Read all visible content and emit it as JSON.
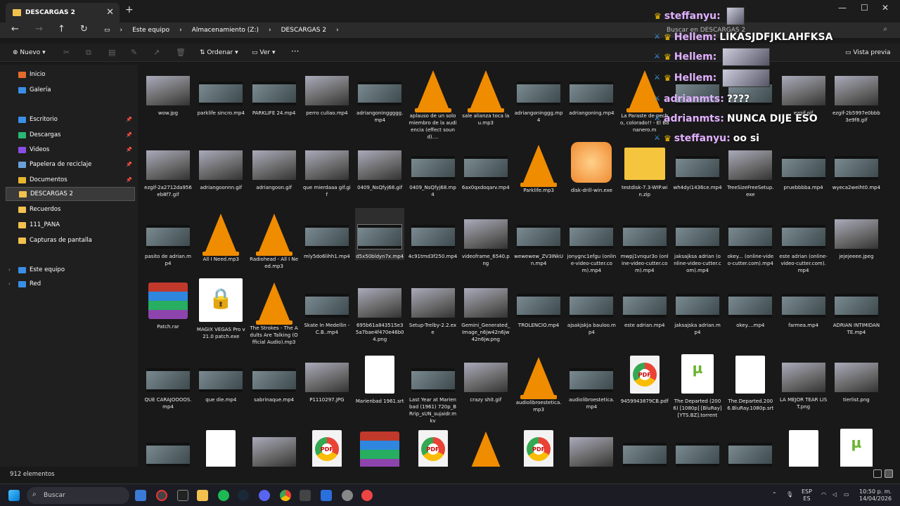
{
  "window": {
    "tab_title": "DESCARGAS 2",
    "new_tab": "+"
  },
  "window_controls": {
    "minimize": "—",
    "maximize": "☐",
    "close": "✕"
  },
  "nav": {
    "back": "←",
    "forward": "→",
    "up": "↑",
    "refresh": "↻"
  },
  "breadcrumb": [
    "Este equipo",
    "Almacenamiento (Z:)",
    "DESCARGAS 2"
  ],
  "search": {
    "placeholder": "Buscar en DESCARGAS 2"
  },
  "toolbar": {
    "new": "Nuevo",
    "sort": "Ordenar",
    "view": "Ver",
    "more": "···",
    "preview": "Vista previa"
  },
  "sidebar": {
    "items": [
      {
        "label": "Inicio",
        "color": "#e36b2c"
      },
      {
        "label": "Galería",
        "color": "#3a8ee6"
      },
      {
        "label": "Escritorio",
        "color": "#3a8ee6",
        "pinned": true
      },
      {
        "label": "Descargas",
        "color": "#2bb673",
        "pinned": true
      },
      {
        "label": "Videos",
        "color": "#8a4de6",
        "pinned": true
      },
      {
        "label": "Papelera de reciclaje",
        "color": "#6aa0d8",
        "pinned": true
      },
      {
        "label": "Documentos",
        "color": "#e8b730",
        "pinned": true
      },
      {
        "label": "DESCARGAS 2",
        "color": "#f2c14e"
      },
      {
        "label": "Recuerdos",
        "color": "#f2c14e"
      },
      {
        "label": "111_PANA",
        "color": "#f2c14e"
      },
      {
        "label": "Capturas de pantalla",
        "color": "#f2c14e"
      },
      {
        "label": "Este equipo",
        "color": "#3a8ee6"
      },
      {
        "label": "Red",
        "color": "#3a8ee6"
      }
    ]
  },
  "files": [
    {
      "name": "wow.jpg",
      "kind": "img"
    },
    {
      "name": "parklife sincro.mp4",
      "kind": "vid"
    },
    {
      "name": "PARKLIFE 24.mp4",
      "kind": "vid"
    },
    {
      "name": "perro culiao.mp4",
      "kind": "img"
    },
    {
      "name": "adriangoninggggg.mp4",
      "kind": "vid"
    },
    {
      "name": "aplauso de un solo miembro de la audiencia (effect sound)....",
      "kind": "cone"
    },
    {
      "name": "sale alianza toca la u.mp3",
      "kind": "cone"
    },
    {
      "name": "adriangoninggg.mp4",
      "kind": "vid"
    },
    {
      "name": "adriangoning.mp4",
      "kind": "vid"
    },
    {
      "name": "La Paraste de pecho, colorado!! - El Bananero.m",
      "kind": "cone"
    },
    {
      "name": "",
      "kind": "vid"
    },
    {
      "name": "",
      "kind": "vid"
    },
    {
      "name": "ezgif.gif",
      "kind": "img"
    },
    {
      "name": "ezgif-2b5997e0bbb3e9f8.gif",
      "kind": "img"
    },
    {
      "name": "ezgif-2a2712da956eb8f7.gif",
      "kind": "img"
    },
    {
      "name": "adriangoonnn.gif",
      "kind": "img"
    },
    {
      "name": "adriangoon.gif",
      "kind": "img"
    },
    {
      "name": "que mierdaaa gif.gif",
      "kind": "img"
    },
    {
      "name": "0409_NsQfyj68.gif",
      "kind": "img"
    },
    {
      "name": "0409_NsQfyj68.mp4",
      "kind": "vid"
    },
    {
      "name": "6ax0qxdoqarv.mp4",
      "kind": "vid"
    },
    {
      "name": "Parklife.mp3",
      "kind": "cone"
    },
    {
      "name": "disk-drill-win.exe",
      "kind": "app"
    },
    {
      "name": "testdisk-7.3-WIP.win.zip",
      "kind": "zip"
    },
    {
      "name": "wh4dyi1436ce.mp4",
      "kind": "vid"
    },
    {
      "name": "TreeSizeFreeSetup.exe",
      "kind": "img"
    },
    {
      "name": "pruebbbba.mp4",
      "kind": "vid"
    },
    {
      "name": "wyeca2weiht0.mp4",
      "kind": "vid"
    },
    {
      "name": "pasito de adrian.mp4",
      "kind": "vid"
    },
    {
      "name": "All I Need.mp3",
      "kind": "cone"
    },
    {
      "name": "Radiohead - All I Need.mp3",
      "kind": "cone"
    },
    {
      "name": "mly5do6lihh1.mp4",
      "kind": "vid"
    },
    {
      "name": "d5x50bldyn7x.mp4",
      "kind": "vid",
      "selected": true
    },
    {
      "name": "4c91tmd3f250.mp4",
      "kind": "vid"
    },
    {
      "name": "videoframe_6540.png",
      "kind": "img"
    },
    {
      "name": "wewewew_ZV3INkUn.mp4",
      "kind": "vid"
    },
    {
      "name": "jonygnc1efgu (online-video-cutter.com).mp4",
      "kind": "vid"
    },
    {
      "name": "mwpj1vnqur3o (online-video-cutter.com).mp4",
      "kind": "vid"
    },
    {
      "name": "jaksajksa adrian (online-video-cutter.com).mp4",
      "kind": "vid"
    },
    {
      "name": "okey... (online-video-cutter.com).mp4",
      "kind": "vid"
    },
    {
      "name": "este adrian (online-video-cutter.com).mp4",
      "kind": "vid"
    },
    {
      "name": "jejejeeee.jpeg",
      "kind": "img"
    },
    {
      "name": "Patch.rar",
      "kind": "rar"
    },
    {
      "name": "MAGIX VEGAS Pro v21.0 patch.exe",
      "kind": "lock"
    },
    {
      "name": "The Strokes - The Adults Are Talking (Official Audio).mp3",
      "kind": "cone"
    },
    {
      "name": "Skate In Medellin - C.B..mp4",
      "kind": "vid"
    },
    {
      "name": "695b61a843515e35a7bae4f470e46b04.png",
      "kind": "img"
    },
    {
      "name": "Setup-Trelby-2.2.exe",
      "kind": "img"
    },
    {
      "name": "Gemini_Generated_Image_n6jw42n6jw42n6jw.png",
      "kind": "img"
    },
    {
      "name": "TROLENCIO.mp4",
      "kind": "vid"
    },
    {
      "name": "ajsakjskja bauloo.mp4",
      "kind": "vid"
    },
    {
      "name": "este adrian.mp4",
      "kind": "vid"
    },
    {
      "name": "jaksajska adrian.mp4",
      "kind": "vid"
    },
    {
      "name": "okey....mp4",
      "kind": "vid"
    },
    {
      "name": "farmea.mp4",
      "kind": "vid"
    },
    {
      "name": "ADRIAN INTIMIDANTE.mp4",
      "kind": "vid"
    },
    {
      "name": "QUE CARAJOOOOS.mp4",
      "kind": "vid"
    },
    {
      "name": "que die.mp4",
      "kind": "vid"
    },
    {
      "name": "sabrinaque.mp4",
      "kind": "vid"
    },
    {
      "name": "P1110297.JPG",
      "kind": "img"
    },
    {
      "name": "Marienbad 1961.srt",
      "kind": "doc"
    },
    {
      "name": "Last Year at Marienbad (1961) 720p_BRrip_sUN_sujaidr.mkv",
      "kind": "vid"
    },
    {
      "name": "crazy shit.gif",
      "kind": "img"
    },
    {
      "name": "audiolibroestetica.mp3",
      "kind": "cone"
    },
    {
      "name": "audiolibroestetica.mp4",
      "kind": "vid"
    },
    {
      "name": "9459943879CB.pdf",
      "kind": "pdf"
    },
    {
      "name": "The Departed (2006) [1080p] [BluRay] [YTS.BZ].torrent",
      "kind": "torrent"
    },
    {
      "name": "The.Departed.2006.BluRay.1080p.srt",
      "kind": "doc"
    },
    {
      "name": "LA MEJOR TEAR LIST.png",
      "kind": "img"
    },
    {
      "name": "tierlist.png",
      "kind": "img"
    },
    {
      "name": "",
      "kind": "vid"
    },
    {
      "name": "",
      "kind": "doc"
    },
    {
      "name": "",
      "kind": "img"
    },
    {
      "name": "",
      "kind": "pdf"
    },
    {
      "name": "",
      "kind": "rar"
    },
    {
      "name": "",
      "kind": "pdf"
    },
    {
      "name": "",
      "kind": "cone"
    },
    {
      "name": "",
      "kind": "pdf"
    },
    {
      "name": "",
      "kind": "img"
    },
    {
      "name": "",
      "kind": "vid"
    },
    {
      "name": "",
      "kind": "vid"
    },
    {
      "name": "",
      "kind": "vid"
    },
    {
      "name": "",
      "kind": "doc"
    },
    {
      "name": "",
      "kind": "torrent"
    }
  ],
  "status": {
    "count": "912 elementos"
  },
  "taskbar": {
    "search": "Buscar",
    "lang": "ESP",
    "lang2": "ES",
    "time": "10:50 p. m.",
    "date": "14/04/2026"
  },
  "chat": [
    {
      "user": "steffanyu:",
      "text": "",
      "emote": true,
      "badges": "crown"
    },
    {
      "user": "Hellem:",
      "text": "LIKASJDFJKLAHFKSA",
      "badges": "sword-crown"
    },
    {
      "user": "Hellem:",
      "text": "",
      "emote": true,
      "badges": "sword-crown"
    },
    {
      "user": "Hellem:",
      "text": "",
      "emote": true,
      "badges": "sword-crown"
    },
    {
      "user": "adrianmts:",
      "text": "????",
      "badges": "sword"
    },
    {
      "user": "adrianmts:",
      "text": "NUNCA DIJE ESO",
      "badges": "sword"
    },
    {
      "user": "steffanyu:",
      "text": "oo si",
      "badges": "sword-crown"
    }
  ]
}
